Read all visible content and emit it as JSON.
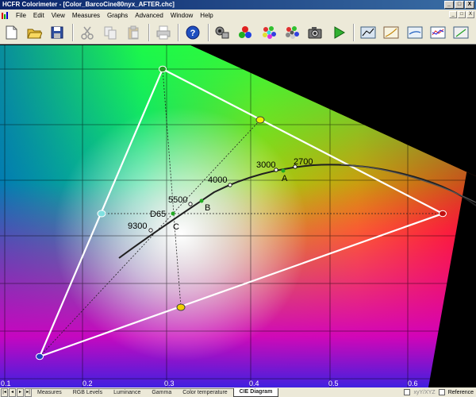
{
  "window": {
    "title": "HCFR Colorimeter - [Color_BarcoCine80nyx_AFTER.chc]",
    "buttons": [
      "_",
      "□",
      "X"
    ]
  },
  "menu": {
    "items": [
      "File",
      "Edit",
      "View",
      "Measures",
      "Graphs",
      "Advanced",
      "Window",
      "Help"
    ],
    "mdi_buttons": [
      "_",
      "□",
      "X"
    ]
  },
  "toolbar": {
    "icons": [
      "new-icon",
      "open-icon",
      "save-icon",
      "cut-icon",
      "copy-icon",
      "paste-icon",
      "print-icon",
      "help-icon",
      "sensor-icon",
      "rgb-icon",
      "colors-icon",
      "gray-colors-icon",
      "camera-icon",
      "play-icon",
      "graph-view-1-icon",
      "graph-view-2-icon",
      "graph-view-3-icon",
      "graph-view-4-icon",
      "graph-view-5-icon"
    ]
  },
  "diagram": {
    "x_ticks": [
      "0.1",
      "0.2",
      "0.3",
      "0.4",
      "0.5",
      "0.6"
    ],
    "temperature_labels": [
      "9300",
      "D65",
      "5500",
      "4000",
      "3000",
      "2700"
    ],
    "point_labels": [
      "A",
      "B",
      "C"
    ],
    "colors": {
      "primary_point": "#22aa22",
      "yellow_point": "#f0d000",
      "gamut_line": "#ffffff",
      "locus_line": "#202020"
    }
  },
  "tabs": {
    "items": [
      "Measures",
      "RGB Levels",
      "Luminance",
      "Gamma",
      "Color temperature",
      "CIE Diagram"
    ],
    "active": "CIE Diagram",
    "checkbox_1_label": "xyY/XYZ",
    "checkbox_2_label": "Reference"
  }
}
